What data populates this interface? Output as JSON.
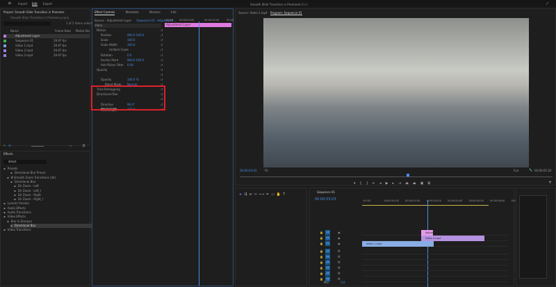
{
  "topbar": {
    "nav": [
      "Import",
      "Edit",
      "Export"
    ],
    "title": "Smooth Slide Transition in Premiere",
    "status": "Edited"
  },
  "project": {
    "title": "Project: Smooth Slide Transition in Premiere",
    "file": "Smooth Slide Transition in Premiere.prproj",
    "selection": "1 of 5 items selected",
    "columns": [
      "Name",
      "Frame Rate",
      "Media Sta"
    ],
    "items": [
      {
        "name": "Adjustment Layer",
        "rate": "",
        "color": "#c07ad8"
      },
      {
        "name": "Sequence 01",
        "rate": "29.97 fps",
        "color": "#3fb24d"
      },
      {
        "name": "Video 1.mp4",
        "rate": "29.97 fps",
        "color": "#7e9ee6"
      },
      {
        "name": "Video 2.mp4",
        "rate": "29.97 fps",
        "color": "#a07ae0"
      },
      {
        "name": "Video 3.mp4",
        "rate": "29.97 fps",
        "color": "#a07ae0"
      }
    ]
  },
  "effect_controls": {
    "tabs": [
      "Effect Controls",
      "Metadata",
      "Markers",
      "Info"
    ],
    "source": "Source - Adjustment Layer",
    "sequence": "Sequence 01 - Adjustment...",
    "section": "Video",
    "clip_label": "Adjustment Layer",
    "timecodes": [
      ":00:00",
      "00:00:03:00",
      "00:00:03:05",
      "00:00"
    ],
    "rows": [
      {
        "label": "Motion",
        "value": ""
      },
      {
        "label": "Position",
        "value": "960.0   540.0"
      },
      {
        "label": "Scale",
        "value": "100.0"
      },
      {
        "label": "Scale Width",
        "value": "100.0"
      },
      {
        "label": "Uniform Scale",
        "value": ""
      },
      {
        "label": "Rotation",
        "value": "0.0"
      },
      {
        "label": "Anchor Point",
        "value": "960.0   540.0"
      },
      {
        "label": "Anti-flicker Filter",
        "value": "0.00"
      },
      {
        "label": "Opacity",
        "value": ""
      },
      {
        "label": "",
        "value": ""
      },
      {
        "label": "Opacity",
        "value": "100.0 %"
      },
      {
        "label": "Blend Mode",
        "value": "Normal"
      },
      {
        "label": "Time Remapping",
        "value": ""
      },
      {
        "label": "Directional Blur",
        "value": ""
      },
      {
        "label": "",
        "value": ""
      },
      {
        "label": "Direction",
        "value": "90.0°"
      },
      {
        "label": "Blur Length",
        "value": "100.0"
      }
    ]
  },
  "effects": {
    "title": "Effects",
    "search": "direct",
    "tree": [
      "Presets",
      "Directional Blur Preset",
      "Ⅲ Smooth Zoom Transitions (3b)",
      "Directional Blur",
      "Dir Zoom - Left",
      "Dir Zoom - Left_I",
      "Dir Zoom - Right",
      "Dir Zoom - Right_I",
      "Lumetri Presets",
      "Audio Effects",
      "Audio Transitions",
      "Video Effects",
      "Blur & Sharpen",
      "Directional Blur",
      "Video Transitions"
    ]
  },
  "program": {
    "source_tab": "Source: Video 2.mp4",
    "program_tab": "Program: Sequence 01",
    "timecode": "00:00:03:03",
    "fit": "Fit",
    "quality": "Full",
    "duration": "00:00:05:20"
  },
  "timeline": {
    "sequence": "Sequence 01",
    "timecode": "00:00:03:03",
    "ruler": [
      ":00:00",
      "00:00:01:00",
      "00:00:02:00",
      "00:00:03:00",
      "00:00:04:00",
      "00:00:05:00",
      "00:00:06:00",
      "00:00"
    ],
    "video_tracks": [
      "V3",
      "V2",
      "V1"
    ],
    "audio_tracks": [
      "A1",
      "A2",
      "A3",
      "A4",
      "A5",
      "A6"
    ],
    "mix": "Mix",
    "mix_value": "0.0",
    "clips": [
      {
        "label": "Adjust",
        "color": "#e59ae8"
      },
      {
        "label": "Video 2.mp4",
        "color": "#b592e0"
      },
      {
        "label": "Video 1.mp4",
        "color": "#89aee6"
      }
    ]
  },
  "colors": {
    "accent": "#4a8ee8",
    "highlight": "#e0202a"
  }
}
